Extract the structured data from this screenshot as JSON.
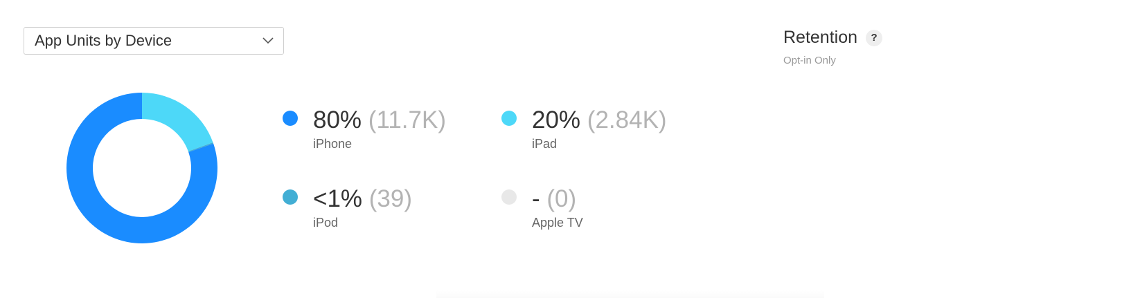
{
  "metric_select": {
    "label": "App Units by Device",
    "icon": "chevron-down-icon"
  },
  "retention": {
    "title": "Retention",
    "help_label": "?",
    "subtitle": "Opt-in Only"
  },
  "chart_data": {
    "type": "pie",
    "categories": [
      "iPhone",
      "iPad",
      "iPod",
      "Apple TV"
    ],
    "values": [
      11700,
      2840,
      39,
      0
    ],
    "percent_labels": [
      "80%",
      "20%",
      "<1%",
      "-"
    ],
    "count_labels": [
      "(11.7K)",
      "(2.84K)",
      "(39)",
      "(0)"
    ],
    "colors": [
      "#1a8cff",
      "#4dd8f8",
      "#42aed4",
      "#e8e8e8"
    ],
    "donut": true,
    "legend": "right"
  }
}
